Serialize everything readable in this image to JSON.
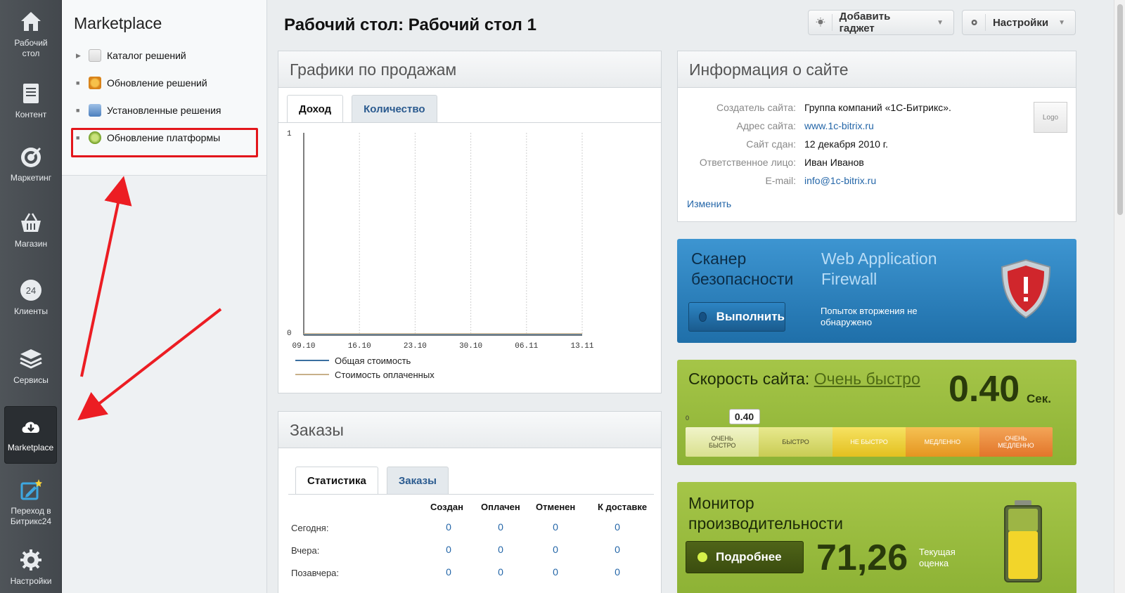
{
  "rail": {
    "items": [
      {
        "label": "Рабочий\nстол",
        "icon": "home-icon"
      },
      {
        "label": "Контент",
        "icon": "document-icon"
      },
      {
        "label": "Маркетинг",
        "icon": "target-icon"
      },
      {
        "label": "Магазин",
        "icon": "basket-icon"
      },
      {
        "label": "Клиенты",
        "icon": "clock-24-icon"
      },
      {
        "label": "Сервисы",
        "icon": "layers-icon"
      },
      {
        "label": "Marketplace",
        "icon": "cloud-download-icon"
      },
      {
        "label": "Переход в\nБитрикс24",
        "icon": "star-edit-icon"
      },
      {
        "label": "Настройки",
        "icon": "gear-icon"
      }
    ]
  },
  "submenu": {
    "title": "Marketplace",
    "items": [
      {
        "label": "Каталог решений",
        "bullet": "▶"
      },
      {
        "label": "Обновление решений",
        "bullet": "■"
      },
      {
        "label": "Установленные решения",
        "bullet": "■"
      },
      {
        "label": "Обновление платформы",
        "bullet": "■"
      }
    ]
  },
  "header": {
    "title": "Рабочий стол: Рабочий стол 1",
    "add_gadget": "Добавить гаджет",
    "settings": "Настройки"
  },
  "sales": {
    "title": "Графики по продажам",
    "tabs": [
      "Доход",
      "Количество"
    ],
    "legend": [
      "Общая стоимость",
      "Стоимость оплаченных"
    ]
  },
  "chart_data": {
    "type": "line",
    "x": [
      "09.10",
      "16.10",
      "23.10",
      "30.10",
      "06.11",
      "13.11"
    ],
    "ylim": [
      0,
      1
    ],
    "yticks": [
      "1",
      "0"
    ],
    "series": [
      {
        "name": "Общая стоимость",
        "values": [
          0,
          0,
          0,
          0,
          0,
          0
        ],
        "color": "#3a6fa0"
      },
      {
        "name": "Стоимость оплаченных",
        "values": [
          0,
          0,
          0,
          0,
          0,
          0
        ],
        "color": "#c8b08a"
      }
    ],
    "grid": true
  },
  "orders": {
    "title": "Заказы",
    "tabs": [
      "Статистика",
      "Заказы"
    ],
    "columns": [
      "Создан",
      "Оплачен",
      "Отменен",
      "К доставке"
    ],
    "rows": [
      {
        "label": "Сегодня:",
        "values": [
          "0",
          "0",
          "0",
          "0"
        ]
      },
      {
        "label": "Вчера:",
        "values": [
          "0",
          "0",
          "0",
          "0"
        ]
      },
      {
        "label": "Позавчера:",
        "values": [
          "0",
          "0",
          "0",
          "0"
        ]
      }
    ]
  },
  "info": {
    "title": "Информация о сайте",
    "rows": [
      {
        "k": "Создатель сайта:",
        "v": "Группа компаний «1С-Битрикс».",
        "link": false
      },
      {
        "k": "Адрес сайта:",
        "v": "www.1c-bitrix.ru",
        "link": true
      },
      {
        "k": "Сайт сдан:",
        "v": "12 декабря 2010 г.",
        "link": false
      },
      {
        "k": "Ответственное лицо:",
        "v": "Иван Иванов",
        "link": false
      },
      {
        "k": "E-mail:",
        "v": "info@1c-bitrix.ru",
        "link": true
      }
    ],
    "edit": "Изменить",
    "logo": "Logo"
  },
  "scanner": {
    "title": "Сканер\nбезопасности",
    "subtitle": "Web Application\nFirewall",
    "button": "Выполнить",
    "note": "Попыток вторжения не\nобнаружено",
    "colors": {
      "bg": "#2b82c0"
    }
  },
  "speed": {
    "title": "Скорость сайта: ",
    "rating": "Очень быстро",
    "value": "0.40",
    "unit": "Сек.",
    "marker": "0.40",
    "zero": "0",
    "segments": [
      "ОЧЕНЬ\nБЫСТРО",
      "БЫСТРО",
      "НЕ БЫСТРО",
      "МЕДЛЕННО",
      "ОЧЕНЬ\nМЕДЛЕННО"
    ],
    "marker_fraction": 0.16
  },
  "perf": {
    "title": "Монитор\nпроизводительности",
    "button": "Подробнее",
    "value": "71,26",
    "sub": "Текущая\nоценка"
  }
}
